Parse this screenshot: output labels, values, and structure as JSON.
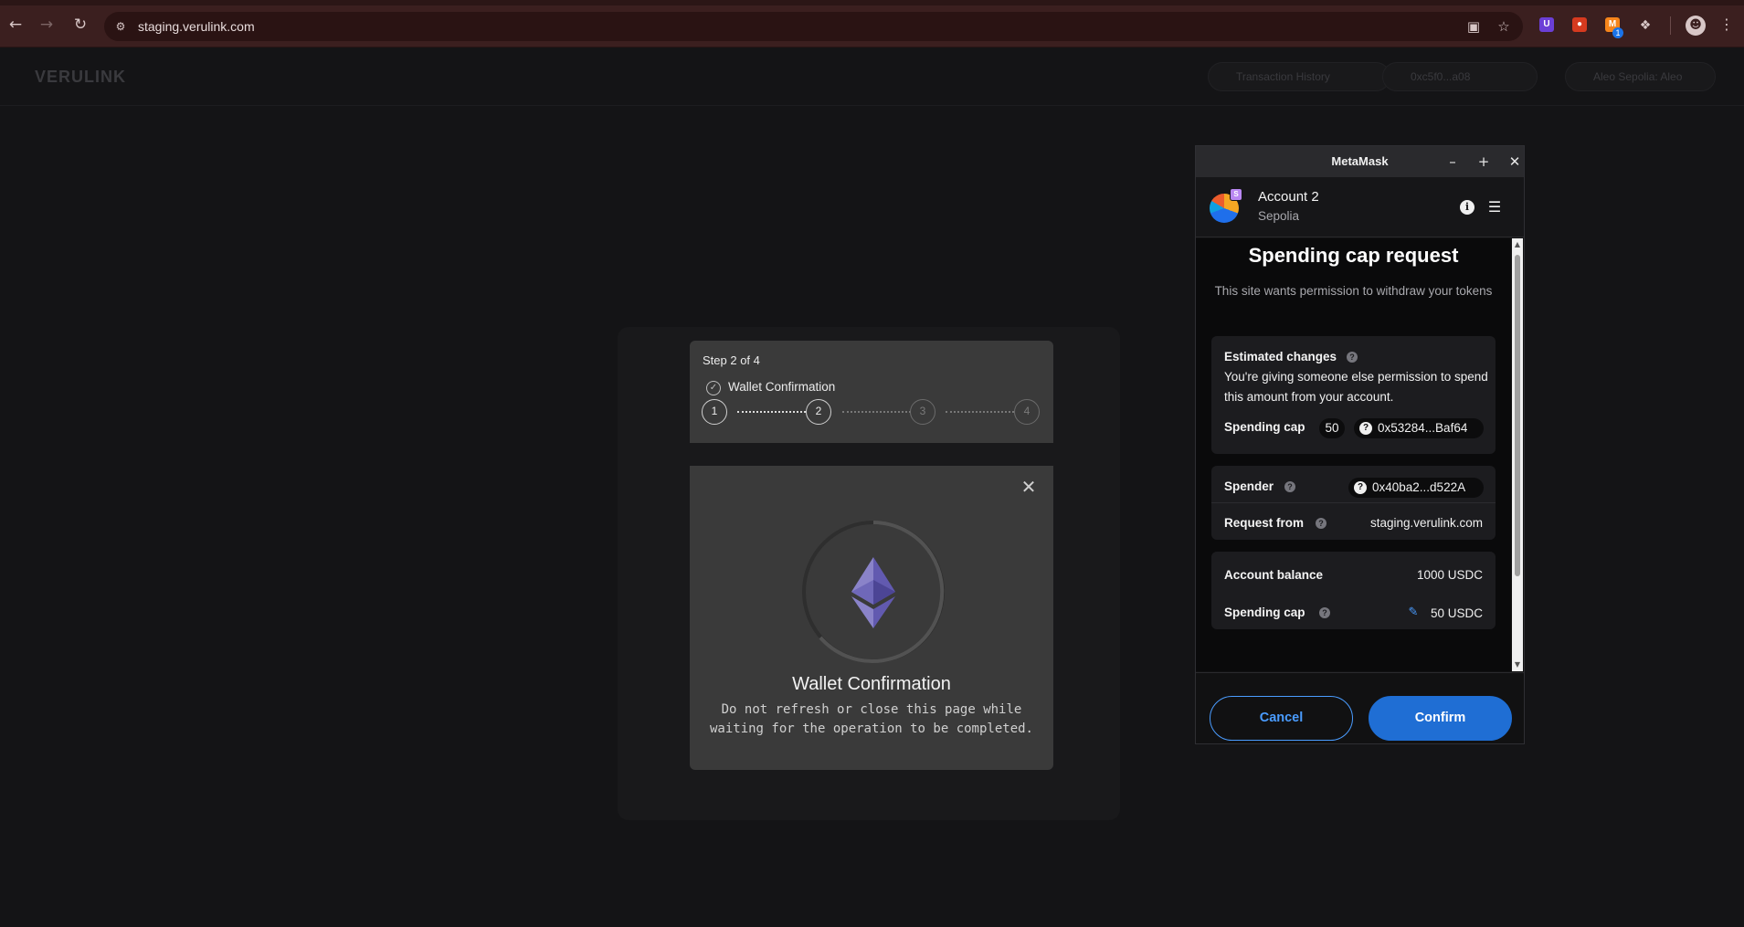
{
  "browser": {
    "url": "staging.verulink.com",
    "back_icon": "arrow-left-icon",
    "forward_icon": "arrow-right-icon",
    "reload_icon": "reload-icon",
    "extension_badge_count": "1"
  },
  "site": {
    "logo": "VERULINK",
    "header_pills": [
      "Transaction History",
      "0xc5f0...a08",
      "Aleo Sepolia: Aleo"
    ]
  },
  "stepper": {
    "title": "Step 2 of 4",
    "current_step_label": "Wallet Confirmation",
    "steps": [
      "1",
      "2",
      "3",
      "4"
    ],
    "current_step": 2
  },
  "wallet_modal": {
    "title": "Wallet Confirmation",
    "description": "Do not refresh or close this page while waiting for the operation to be completed."
  },
  "metamask": {
    "window_title": "MetaMask",
    "account_name": "Account 2",
    "network": "Sepolia",
    "avatar_badge": "S",
    "heading": "Spending cap request",
    "subheading": "This site wants permission to withdraw your tokens",
    "estimated_changes": {
      "label": "Estimated changes",
      "text": "You're giving someone else permission to spend this amount from your account.",
      "spending_cap_label": "Spending cap",
      "amount": "50",
      "token_address": "0x53284...Baf64"
    },
    "details": {
      "spender_label": "Spender",
      "spender_address": "0x40ba2...d522A",
      "request_from_label": "Request from",
      "request_from_value": "staging.verulink.com"
    },
    "balance": {
      "account_balance_label": "Account balance",
      "account_balance_value": "1000 USDC",
      "spending_cap_label": "Spending cap",
      "spending_cap_value": "50 USDC"
    },
    "buttons": {
      "cancel": "Cancel",
      "confirm": "Confirm"
    }
  },
  "colors": {
    "accent": "#1f6ed4",
    "link": "#4a9cff",
    "chrome": "#3b1f1f"
  }
}
